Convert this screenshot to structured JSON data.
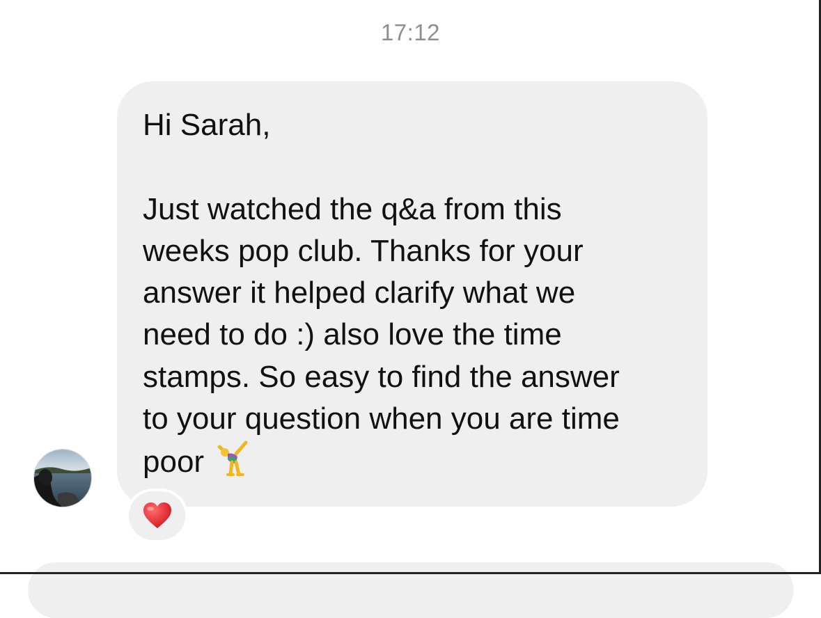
{
  "conversation": {
    "timestamp": "17:12",
    "message": {
      "greeting": "Hi Sarah,",
      "body_lines": [
        "Just watched the q&a from this",
        "weeks pop club. Thanks for your",
        "answer it helped clarify what we",
        "need to do :) also love the time",
        "stamps. So easy to find the answer",
        "to your question when you are time"
      ],
      "last_word": "poor",
      "emoji_icon": "person-cartwheeling-icon"
    },
    "reaction": {
      "icon": "heart-icon",
      "color": "#e0222a"
    },
    "sender_avatar": {
      "icon": "avatar-photo"
    }
  },
  "colors": {
    "bubble_background": "#efefef",
    "timestamp_color": "#8e8e93",
    "text_color": "#111111"
  }
}
